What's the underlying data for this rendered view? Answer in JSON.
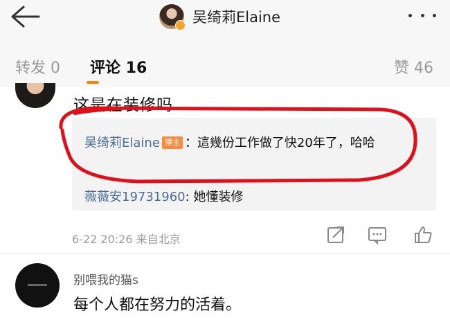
{
  "header": {
    "title": "吴绮莉Elaine",
    "back_icon": "arrow-left-icon",
    "more_icon": "more-dots-icon",
    "verified_color": "#f7a32b"
  },
  "tabs": [
    {
      "label": "转发 0"
    },
    {
      "label": "评论 16"
    },
    {
      "label": "赞 46"
    }
  ],
  "accent_color": "#ff8200",
  "comments": [
    {
      "text": "这是在装修吗",
      "replies": [
        {
          "author": "吴绮莉Elaine",
          "badge": "博主",
          "text": "：這幾份工作做了快20年了，哈哈"
        },
        {
          "author": "薇薇安19731960",
          "text": ": 她懂装修"
        }
      ],
      "meta": "6-22 20:26 来自北京",
      "actions": [
        "share-icon",
        "comment-icon",
        "like-icon"
      ]
    },
    {
      "author": "别喂我的猫s",
      "text": "每个人都在努力的活着。"
    }
  ],
  "annotation_color": "#e0101a"
}
